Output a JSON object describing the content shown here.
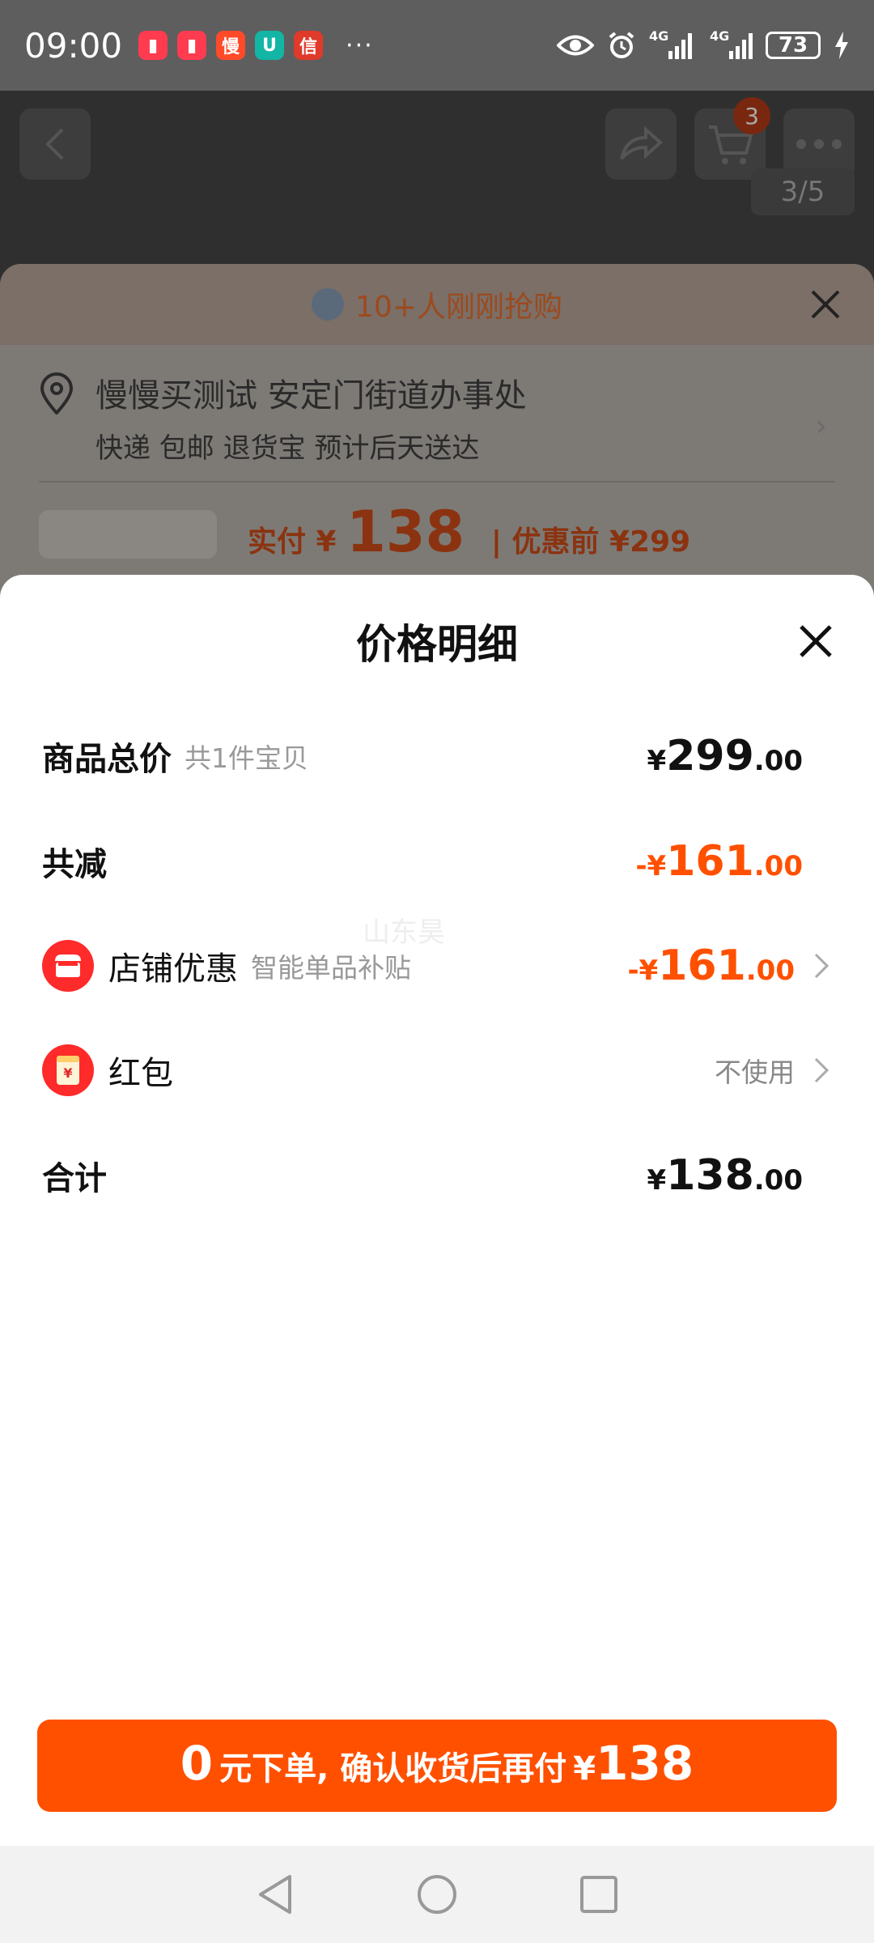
{
  "status_bar": {
    "time": "09:00",
    "app_icons": [
      {
        "name": "red-book-icon",
        "glyph": "▮",
        "color": "#ff3b4f"
      },
      {
        "name": "red-book-icon-2",
        "glyph": "▮",
        "color": "#ff3b4f"
      },
      {
        "name": "man-app-icon",
        "glyph": "慢",
        "color": "#ff4a2a"
      },
      {
        "name": "teal-app-icon",
        "glyph": "U",
        "color": "#13b5a5"
      },
      {
        "name": "red-app-icon",
        "glyph": "信",
        "color": "#e03a2a"
      }
    ],
    "more": "···",
    "network_label": "4G",
    "network_label_2": "4G",
    "battery": "73"
  },
  "background_page": {
    "cart_count": "3",
    "image_counter": "3/5",
    "buyers_text": "10+人刚刚抢购",
    "address_name": "慢慢买测试 安定门街道办事处",
    "address_sub": "快递 包邮 退货宝 预计后天送达",
    "pay_label": "实付 ¥",
    "pay_amount": "138",
    "original_label": "| 优惠前 ¥299"
  },
  "sheet": {
    "title": "价格明细",
    "rows": {
      "total": {
        "label": "商品总价",
        "sub": "共1件宝贝",
        "yen": "¥",
        "int": "299",
        "dec": ".00"
      },
      "discount": {
        "label": "共减",
        "yen": "-¥",
        "int": "161",
        "dec": ".00"
      },
      "shop_coupon": {
        "label": "店铺优惠",
        "sub": "智能单品补贴",
        "yen": "-¥",
        "int": "161",
        "dec": ".00"
      },
      "red_packet": {
        "label": "红包",
        "value": "不使用"
      },
      "sum": {
        "label": "合计",
        "yen": "¥",
        "int": "138",
        "dec": ".00"
      }
    },
    "watermark": "山东昊"
  },
  "cta": {
    "zero": "0",
    "text": "元下单, 确认收货后再付",
    "yen": "¥",
    "amount": "138"
  },
  "colors": {
    "accent": "#ff5000",
    "icon_red": "#ff2a2a"
  }
}
